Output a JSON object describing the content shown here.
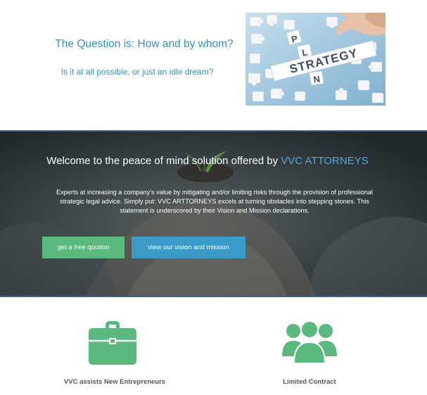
{
  "intro": {
    "title": "The Question is: How and by whom?",
    "subtitle": "Is it at all possible, or just an idle dream?"
  },
  "puzzle_image": {
    "vertical_word": "PLAN",
    "horizontal_word": "STRATEGY"
  },
  "hero": {
    "title_prefix": "Welcome to the peace of mind solution offered by ",
    "title_brand": "VVC ATTORNEYS",
    "body": "Experts at increasing a company's value by mitigating and/or limiting risks through the provision of professional strategic legal advice. Simply put: VVC ARTTORNEYS excels at turning obstacles into stepping stones. This statement is underscored by their Vision and Mission declarations.",
    "quote_button": "get a free qoution",
    "vision_button": "view our vision and mission"
  },
  "features": [
    {
      "icon": "briefcase-icon",
      "label": "VVC assists New Entrepreneurs"
    },
    {
      "icon": "group-icon",
      "label": "Limited Contract"
    }
  ],
  "colors": {
    "accent_blue": "#3a8fb8",
    "brand_blue": "#4fa8dc",
    "green": "#5bb97f",
    "button_blue": "#3a9ac8"
  }
}
